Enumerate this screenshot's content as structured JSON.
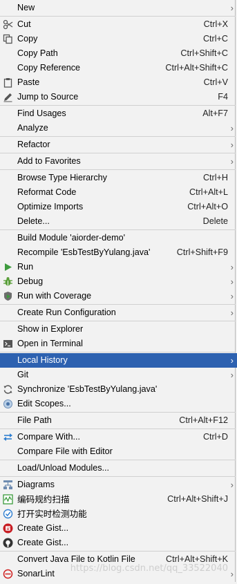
{
  "menu": {
    "items": [
      {
        "label": "New",
        "shortcut": "",
        "arrow": "›",
        "icon": ""
      },
      {
        "label": "Cut",
        "shortcut": "Ctrl+X",
        "arrow": "",
        "icon": "scissors-icon"
      },
      {
        "label": "Copy",
        "shortcut": "Ctrl+C",
        "arrow": "",
        "icon": "copy-icon"
      },
      {
        "label": "Copy Path",
        "shortcut": "Ctrl+Shift+C",
        "arrow": "",
        "icon": ""
      },
      {
        "label": "Copy Reference",
        "shortcut": "Ctrl+Alt+Shift+C",
        "arrow": "",
        "icon": ""
      },
      {
        "label": "Paste",
        "shortcut": "Ctrl+V",
        "arrow": "",
        "icon": "clipboard-icon"
      },
      {
        "label": "Jump to Source",
        "shortcut": "F4",
        "arrow": "",
        "icon": "pencil-icon"
      },
      {
        "label": "Find Usages",
        "shortcut": "Alt+F7",
        "arrow": "",
        "icon": ""
      },
      {
        "label": "Analyze",
        "shortcut": "",
        "arrow": "›",
        "icon": ""
      },
      {
        "label": "Refactor",
        "shortcut": "",
        "arrow": "›",
        "icon": ""
      },
      {
        "label": "Add to Favorites",
        "shortcut": "",
        "arrow": "›",
        "icon": ""
      },
      {
        "label": "Browse Type Hierarchy",
        "shortcut": "Ctrl+H",
        "arrow": "",
        "icon": ""
      },
      {
        "label": "Reformat Code",
        "shortcut": "Ctrl+Alt+L",
        "arrow": "",
        "icon": ""
      },
      {
        "label": "Optimize Imports",
        "shortcut": "Ctrl+Alt+O",
        "arrow": "",
        "icon": ""
      },
      {
        "label": "Delete...",
        "shortcut": "Delete",
        "arrow": "",
        "icon": ""
      },
      {
        "label": "Build Module 'aiorder-demo'",
        "shortcut": "",
        "arrow": "",
        "icon": ""
      },
      {
        "label": "Recompile 'EsbTestByYulang.java'",
        "shortcut": "Ctrl+Shift+F9",
        "arrow": "",
        "icon": ""
      },
      {
        "label": "Run",
        "shortcut": "",
        "arrow": "›",
        "icon": "run-icon"
      },
      {
        "label": "Debug",
        "shortcut": "",
        "arrow": "›",
        "icon": "debug-icon"
      },
      {
        "label": "Run with Coverage",
        "shortcut": "",
        "arrow": "›",
        "icon": "coverage-icon"
      },
      {
        "label": "Create Run Configuration",
        "shortcut": "",
        "arrow": "›",
        "icon": ""
      },
      {
        "label": "Show in Explorer",
        "shortcut": "",
        "arrow": "",
        "icon": ""
      },
      {
        "label": "Open in Terminal",
        "shortcut": "",
        "arrow": "",
        "icon": "terminal-icon"
      },
      {
        "label": "Local History",
        "shortcut": "",
        "arrow": "›",
        "icon": ""
      },
      {
        "label": "Git",
        "shortcut": "",
        "arrow": "›",
        "icon": ""
      },
      {
        "label": "Synchronize 'EsbTestByYulang.java'",
        "shortcut": "",
        "arrow": "",
        "icon": "sync-icon"
      },
      {
        "label": "Edit Scopes...",
        "shortcut": "",
        "arrow": "",
        "icon": "scopes-icon"
      },
      {
        "label": "File Path",
        "shortcut": "Ctrl+Alt+F12",
        "arrow": "",
        "icon": ""
      },
      {
        "label": "Compare With...",
        "shortcut": "Ctrl+D",
        "arrow": "",
        "icon": "compare-icon"
      },
      {
        "label": "Compare File with Editor",
        "shortcut": "",
        "arrow": "",
        "icon": ""
      },
      {
        "label": "Load/Unload Modules...",
        "shortcut": "",
        "arrow": "",
        "icon": ""
      },
      {
        "label": "Diagrams",
        "shortcut": "",
        "arrow": "›",
        "icon": "diagrams-icon"
      },
      {
        "label": "编码规约扫描",
        "shortcut": "Ctrl+Alt+Shift+J",
        "arrow": "",
        "icon": "scan-icon"
      },
      {
        "label": "打开实时检测功能",
        "shortcut": "",
        "arrow": "",
        "icon": "realtime-check-icon"
      },
      {
        "label": "Create Gist...",
        "shortcut": "",
        "arrow": "",
        "icon": "gitee-icon"
      },
      {
        "label": "Create Gist...",
        "shortcut": "",
        "arrow": "",
        "icon": "github-icon"
      },
      {
        "label": "Convert Java File to Kotlin File",
        "shortcut": "Ctrl+Alt+Shift+K",
        "arrow": "",
        "icon": ""
      },
      {
        "label": "SonarLint",
        "shortcut": "",
        "arrow": "›",
        "icon": "sonarlint-icon"
      }
    ],
    "watermark": "https://blog.csdn.net/qq_33522040"
  }
}
